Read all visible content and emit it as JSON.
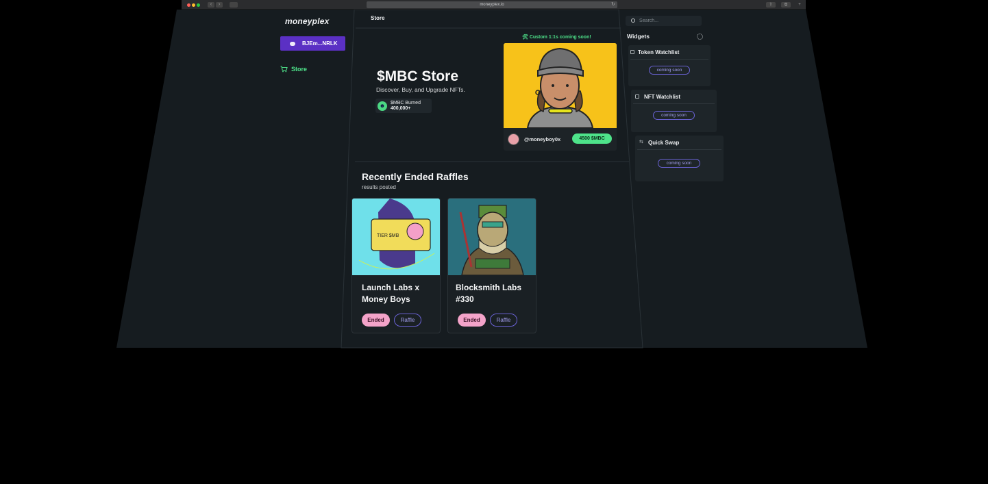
{
  "browser": {
    "url": "moneyplex.io",
    "reload_glyph": "↻",
    "back_glyph": "‹",
    "forward_glyph": "›",
    "share_glyph": "⇧",
    "tabs_glyph": "⧉",
    "new_tab_glyph": "+"
  },
  "sidebar": {
    "logo": "moneyplex",
    "wallet_label": "BJEm...NRLK",
    "nav": [
      {
        "label": "Store",
        "icon": "cart-icon"
      }
    ]
  },
  "header": {
    "title": "Store"
  },
  "hero": {
    "title": "$MBC Store",
    "subtitle": "Discover, Buy, and Upgrade NFTs.",
    "burned_label": "$MBC Burned",
    "burned_value": "400,000+",
    "coming_soon": "🛠 Custom 1:1s coming soon!",
    "featured": {
      "owner": "@moneyboy0x",
      "price": "4500 $MBC"
    }
  },
  "raffles": {
    "title": "Recently Ended Raffles",
    "subtitle": "results posted",
    "items": [
      {
        "name": "Launch Labs x Money Boys",
        "status": "Ended",
        "tag": "Raffle",
        "card_text": "TIER $MB"
      },
      {
        "name": "Blocksmith Labs #330",
        "status": "Ended",
        "tag": "Raffle"
      }
    ]
  },
  "right": {
    "search_placeholder": "Search...",
    "widgets_title": "Widgets",
    "widgets": [
      {
        "title": "Token Watchlist",
        "status": "coming soon"
      },
      {
        "title": "NFT Watchlist",
        "status": "coming soon"
      },
      {
        "title": "Quick Swap",
        "status": "coming soon"
      }
    ]
  },
  "colors": {
    "accent": "#4ee38a",
    "brand": "#5b30c4",
    "ended": "#f4a3c9",
    "raffle": "#6b63d6",
    "featured_bg": "#f7c21a"
  }
}
